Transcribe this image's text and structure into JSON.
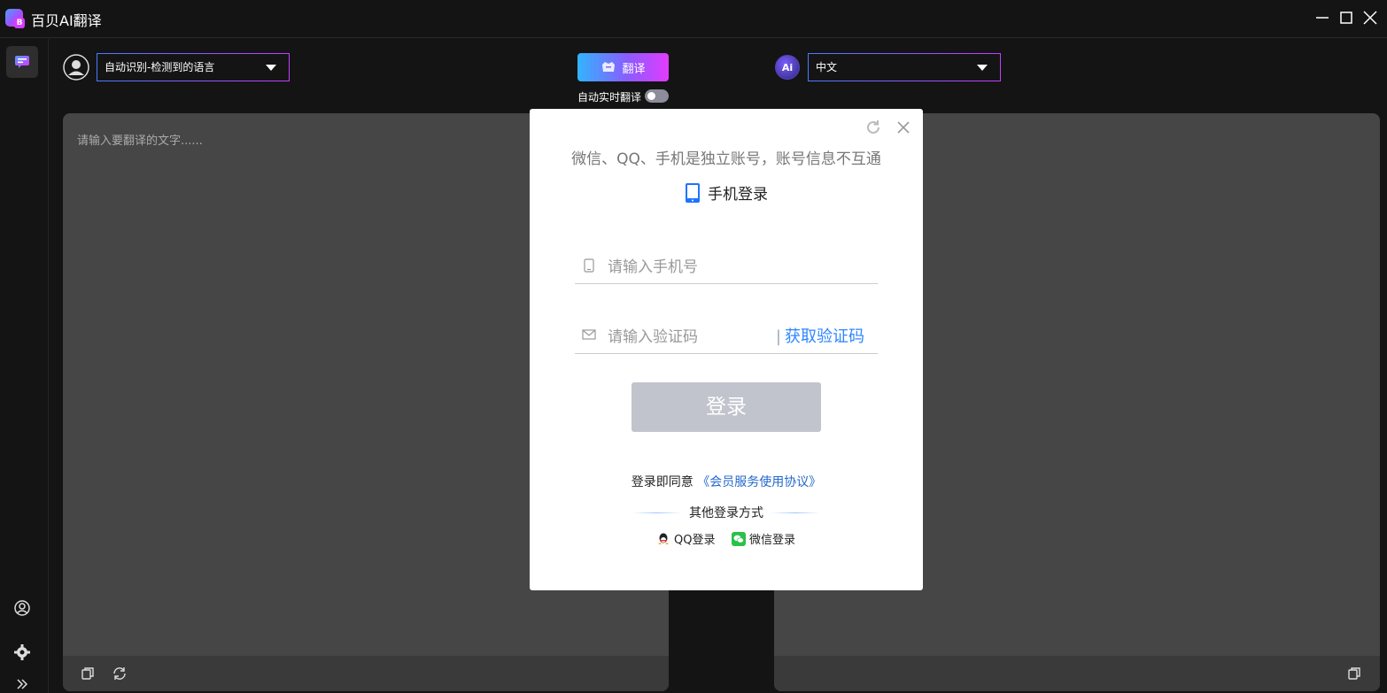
{
  "app": {
    "title": "百贝AI翻译",
    "logo_letter": "B"
  },
  "toolbar": {
    "source_lang": "自动识别-检测到的语言",
    "target_lang": "中文",
    "translate_label": "翻译",
    "auto_translate_label": "自动实时翻译",
    "auto_translate_on": false,
    "ai_badge": "Ai"
  },
  "source_panel": {
    "placeholder": "请输入要翻译的文字......"
  },
  "login_modal": {
    "notice": "微信、QQ、手机是独立账号，账号信息不互通",
    "method_title": "手机登录",
    "phone_placeholder": "请输入手机号",
    "code_placeholder": "请输入验证码",
    "get_code_separator": "|",
    "get_code_label": "获取验证码",
    "login_label": "登录",
    "agree_prefix": "登录即同意",
    "agree_link": "《会员服务使用协议》",
    "other_title": "其他登录方式",
    "qq_label": "QQ登录",
    "wechat_label": "微信登录"
  },
  "colors": {
    "accent_link": "#2f86ff",
    "login_disabled": "#c1c4cd",
    "panel_bg": "#464646",
    "app_bg": "#141414"
  },
  "icons": {
    "sidebar": [
      "chat-translate-icon",
      "user-icon",
      "gear-icon",
      "expand-icon"
    ],
    "window": [
      "minimize-icon",
      "maximize-icon",
      "close-icon"
    ]
  }
}
